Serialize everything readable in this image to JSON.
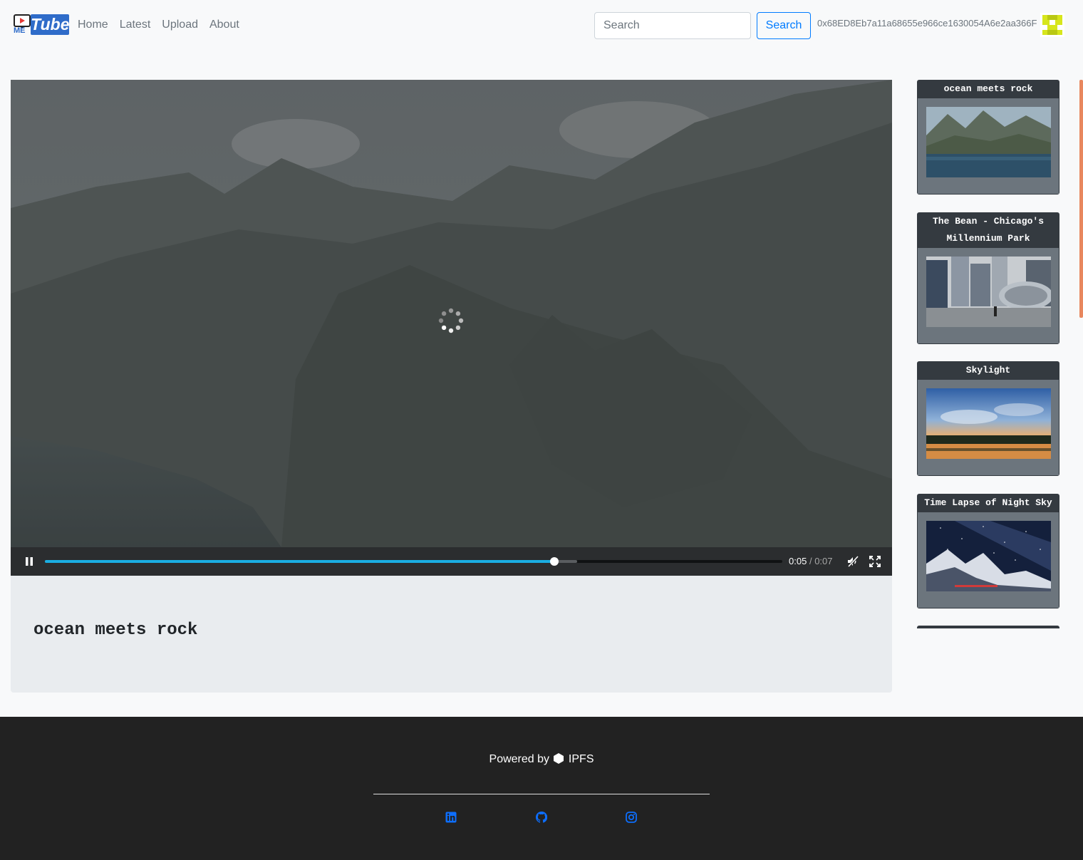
{
  "brand": {
    "logo_text": "Tube",
    "logo_sub": "ME"
  },
  "nav": {
    "links": [
      "Home",
      "Latest",
      "Upload",
      "About"
    ]
  },
  "search": {
    "placeholder": "Search",
    "button_label": "Search"
  },
  "account": {
    "address": "0x68ED8Eb7a11a68655e966ce1630054A6e2aa366F"
  },
  "player": {
    "current_time": "0:05",
    "separator": "/",
    "duration": "0:07",
    "progress_fraction": 0.691,
    "buffered_fraction": 0.722,
    "loading": true
  },
  "video": {
    "title": "ocean meets rock"
  },
  "related": [
    {
      "title": "ocean meets rock",
      "thumb": "mountain-lake"
    },
    {
      "title": "The Bean - Chicago's Millennium Park",
      "thumb": "city-bean"
    },
    {
      "title": "Skylight",
      "thumb": "sunset-sky"
    },
    {
      "title": "Time Lapse of Night Sky",
      "thumb": "night-sky"
    }
  ],
  "footer": {
    "powered_by": "Powered by",
    "ipfs": "IPFS",
    "social": [
      "linkedin-icon",
      "github-icon",
      "instagram-icon"
    ]
  },
  "colors": {
    "accent": "#007bff",
    "progress": "#1aaee2",
    "card_header": "#343a40",
    "footer_bg": "#222222",
    "scrollbar": "#e8875e"
  }
}
